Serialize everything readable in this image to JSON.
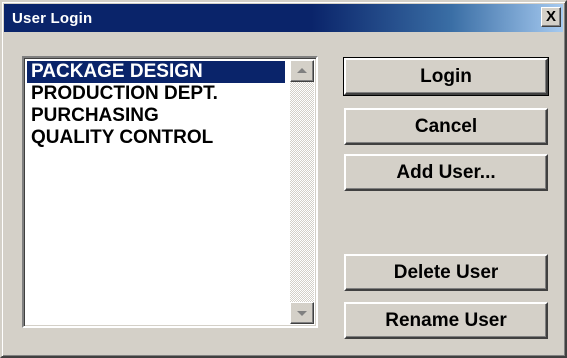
{
  "window": {
    "title": "User Login",
    "close_label": "X"
  },
  "user_list": {
    "items": [
      {
        "label": "PACKAGE DESIGN",
        "selected": true
      },
      {
        "label": "PRODUCTION DEPT.",
        "selected": false
      },
      {
        "label": "PURCHASING",
        "selected": false
      },
      {
        "label": "QUALITY CONTROL",
        "selected": false
      }
    ]
  },
  "buttons": {
    "login": "Login",
    "cancel": "Cancel",
    "add_user": "Add User...",
    "delete_user": "Delete User",
    "rename_user": "Rename User"
  },
  "colors": {
    "selection": "#0a246a",
    "face": "#d4d0c8"
  }
}
